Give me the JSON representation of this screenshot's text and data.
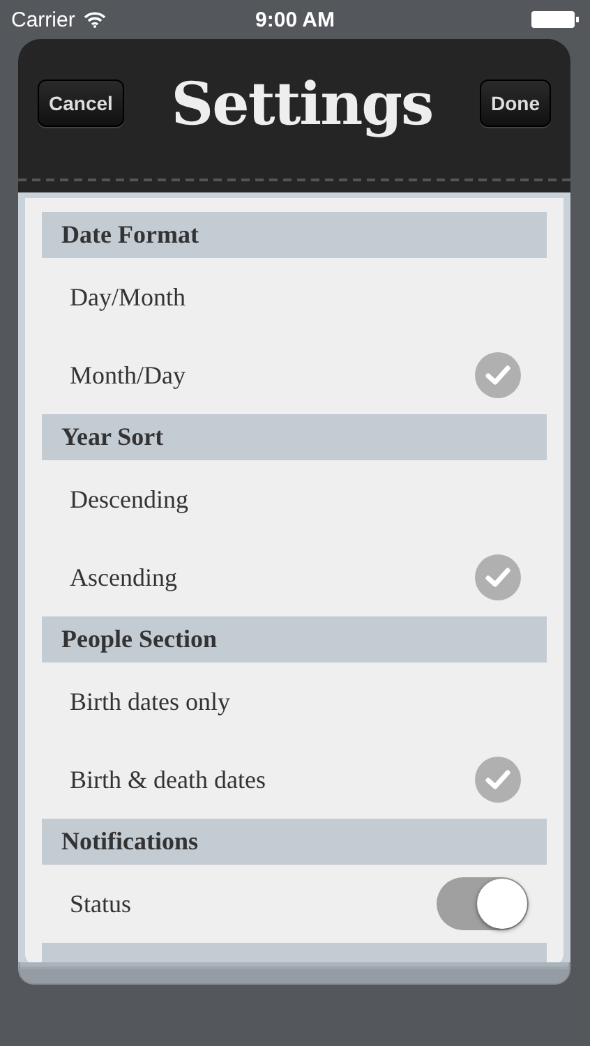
{
  "status_bar": {
    "carrier": "Carrier",
    "time": "9:00 AM"
  },
  "nav": {
    "title": "Settings",
    "left_button": "Cancel",
    "right_button": "Done"
  },
  "sections": [
    {
      "header": "Date Format",
      "rows": [
        {
          "kind": "option",
          "label": "Day/Month",
          "selected": false
        },
        {
          "kind": "option",
          "label": "Month/Day",
          "selected": true
        }
      ]
    },
    {
      "header": "Year Sort",
      "rows": [
        {
          "kind": "option",
          "label": "Descending",
          "selected": false
        },
        {
          "kind": "option",
          "label": "Ascending",
          "selected": true
        }
      ]
    },
    {
      "header": "People Section",
      "rows": [
        {
          "kind": "option",
          "label": "Birth dates only",
          "selected": false
        },
        {
          "kind": "option",
          "label": "Birth & death dates",
          "selected": true
        }
      ]
    },
    {
      "header": "Notifications",
      "rows": [
        {
          "kind": "toggle",
          "label": "Status",
          "on": true
        }
      ]
    }
  ]
}
